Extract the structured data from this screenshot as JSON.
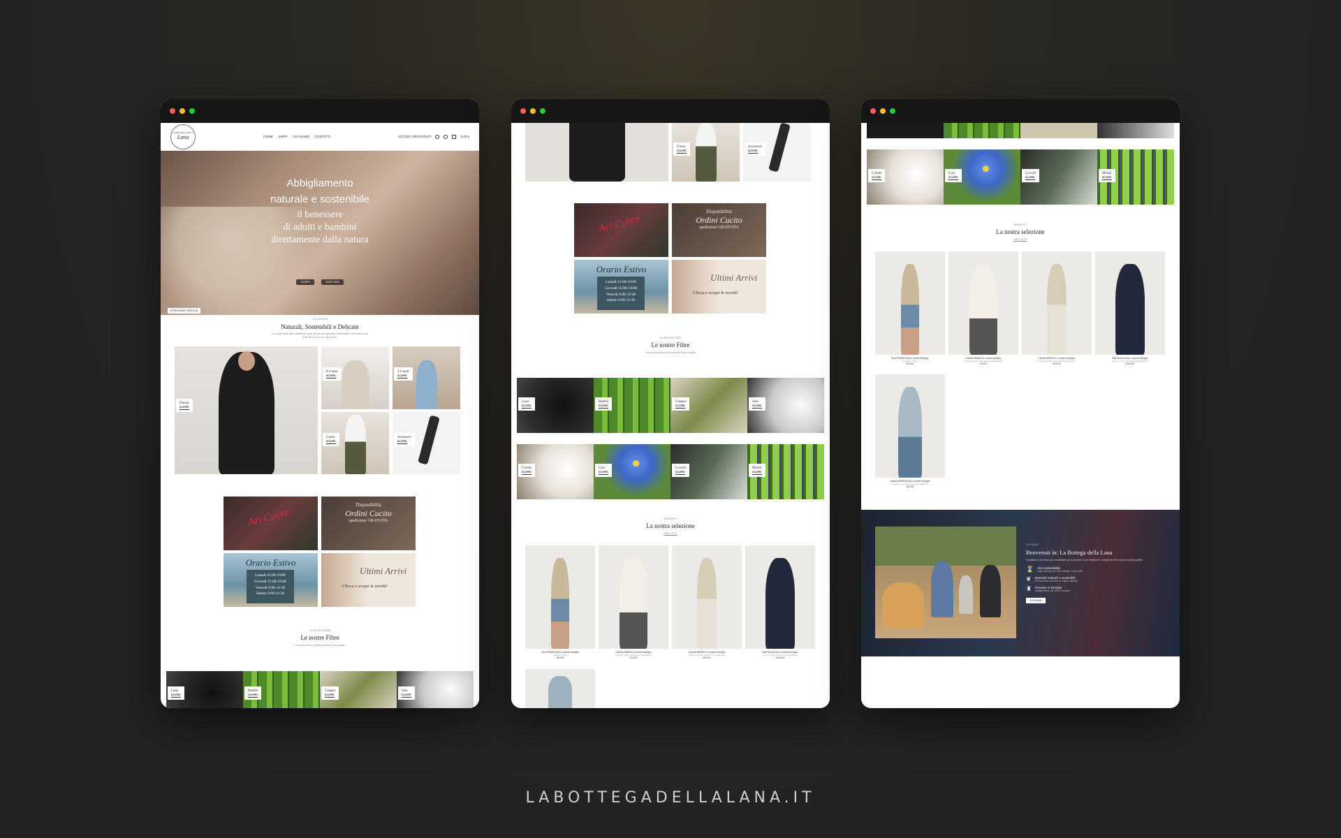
{
  "footer": {
    "url": "LABOTTEGADELLALANA.IT"
  },
  "site": {
    "logo_line1": "LA BOTTEGA DELLA",
    "logo_line2": "Lana",
    "nav": [
      "HOME",
      "SHOP",
      "CHI SIAMO",
      "CONTATTI"
    ],
    "account": "ACCEDI / REGISTRATI",
    "cart": "0,00 €"
  },
  "hero": {
    "line1": "Abbigliamento",
    "line2": "naturale e sostenibile",
    "line3": "il benessere",
    "line4": "di adulti e bambini",
    "line5": "direttamente dalla natura",
    "btn1": "SCOPRI",
    "btn2": "SHOP NOW",
    "badge": "SPEDIZIONE GRATUITA"
  },
  "section1": {
    "kicker": "COLLEZIONE",
    "title": "Naturali, Sostenibili e Delicate",
    "desc": "La meglio delle fibre naturali per abiti, pensati per garantire sostenibilità e benessere alla pelle dei più piccoli e dei grandi."
  },
  "categories": [
    {
      "label": "Donna",
      "cta": "SCOPRI"
    },
    {
      "label": "0-2 anni",
      "cta": "SCOPRI"
    },
    {
      "label": "2-6 anni",
      "cta": "SCOPRI"
    },
    {
      "label": "Uomo",
      "cta": "SCOPRI"
    },
    {
      "label": "Accessori",
      "cta": "SCOPRI"
    }
  ],
  "promos": {
    "p1": "Ari Cuore",
    "p2_l1": "Disponibilità",
    "p2_l2": "Ordini Cucito",
    "p2_l3": "spedizione GRATUITA",
    "p3_title": "Orario Estivo",
    "p3_lines": [
      "Lunedì 15:00-19:00",
      "Giovedì 15:00-19:00",
      "Venerdì 9:00-12:30",
      "Sabato 9:00-12:30"
    ],
    "p4_title": "Ultimi Arrivi",
    "p4_sub": "Clicca e scopri le novità!"
  },
  "fibers": {
    "kicker": "LE NOSTRE FIBRE",
    "title": "Le nostre Fibre",
    "desc": "Una panoramica di fibre naturali di alta qualità",
    "items": [
      "Lana",
      "Bambù",
      "Canapa",
      "Seta",
      "Cotone",
      "Lino",
      "Lyocell",
      "Modal"
    ],
    "cta": "SCOPRI"
  },
  "selection": {
    "kicker": "PRODOTTI",
    "title": "La nostra selezione",
    "link": "VEDI TUTTI",
    "products": [
      {
        "name": "Short PANNOLINA in cotone biologico",
        "sub": "Organic Cotton",
        "price": "59,00 €"
      },
      {
        "name": "Camicia BIANCA in cotone biologico",
        "sub": "Organic Cotton, lavorazione artigianale",
        "price": "74,00 €"
      },
      {
        "name": "Camicia BEANCO in cotone biologico",
        "sub": "Organic Cotton, lavorazione artigianale",
        "price": "69,00 €"
      },
      {
        "name": "Maxi BLUA in lino e cotone biologico",
        "sub": "Lino e cotone, lavorazione artigianale",
        "price": "109,00 €"
      },
      {
        "name": "Camicia BARDALINA in cotone biologico",
        "sub": "Organic Cotton, lavorazione artigianale",
        "price": "69,00 €"
      }
    ]
  },
  "welcome": {
    "kicker": "CHI SIAMO",
    "title": "Benvenuti in: La Bottega della Lana",
    "desc": "Crediamo in un futuro più sostenibile per le persone e per l'ambiente, scegliendo fibre naturali di alta qualità.",
    "features": [
      {
        "title": "Alta sostenibilità",
        "desc": "Capi realizzati con fibre naturali e rinnovabili"
      },
      {
        "title": "Materiali naturali e sostenibili",
        "desc": "Selezioniamo solo fibre di origine naturale"
      },
      {
        "title": "Pensato in famiglia",
        "desc": "Abbigliamento per adulti e bambini"
      }
    ],
    "cta": "CHI SIAMO"
  },
  "colors": {
    "accent": "#4a3d35",
    "bg": "#232323",
    "window_bar": "#161616"
  }
}
